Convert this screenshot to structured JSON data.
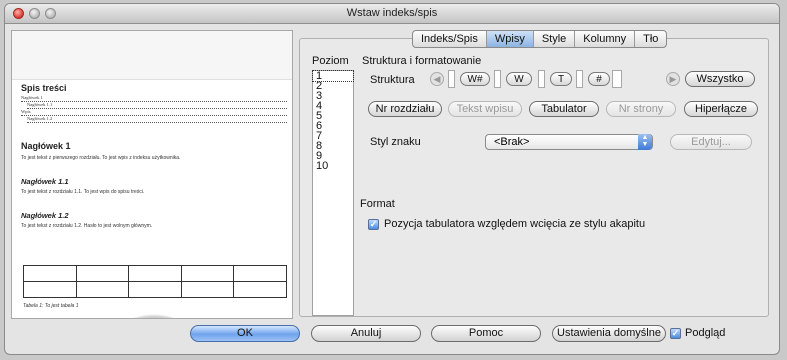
{
  "window": {
    "title": "Wstaw indeks/spis"
  },
  "tabs": [
    {
      "label": "Indeks/Spis"
    },
    {
      "label": "Wpisy"
    },
    {
      "label": "Style"
    },
    {
      "label": "Kolumny"
    },
    {
      "label": "Tło"
    }
  ],
  "preview": {
    "toc_title": "Spis treści",
    "toc_lines": [
      "Nagłówek 1",
      "Nagłówek 1.1",
      "Wpis",
      "Nagłówek 1.2"
    ],
    "h1": "Nagłówek 1",
    "p1": "To jest tekst z pierwszego rozdziału. To jest wpis z indeksu użytkownika.",
    "h11": "Nagłówek 1.1",
    "p11": "To jest tekst z rozdziału 1.1. To jest wpis do spisu treści.",
    "h12": "Nagłówek 1.2",
    "p12": "To jest tekst z rozdziału 1.2. Hasło to jest wolnym głównym.",
    "caption": "Tabela 1: To jest tabela 1"
  },
  "levels": {
    "header": "Poziom",
    "items": [
      "1",
      "2",
      "3",
      "4",
      "5",
      "6",
      "7",
      "8",
      "9",
      "10"
    ]
  },
  "structure": {
    "section_label": "Struktura i formatowanie",
    "row_label": "Struktura",
    "tokens": [
      "W#",
      "W",
      "T",
      "#"
    ],
    "all_button": "Wszystko",
    "buttons": {
      "chapter_no": "Nr rozdziału",
      "entry_text": "Tekst wpisu",
      "tab": "Tabulator",
      "page_no": "Nr strony",
      "hyperlink": "Hiperłącze"
    },
    "char_style_label": "Styl znaku",
    "char_style_value": "<Brak>",
    "edit_button": "Edytuj..."
  },
  "format": {
    "label": "Format",
    "checkbox_label": "Pozycja tabulatora względem wcięcia ze stylu akapitu",
    "checked": true
  },
  "footer": {
    "ok": "OK",
    "cancel": "Anuluj",
    "help": "Pomoc",
    "defaults": "Ustawienia domyślne",
    "preview_label": "Podgląd",
    "preview_checked": true
  }
}
